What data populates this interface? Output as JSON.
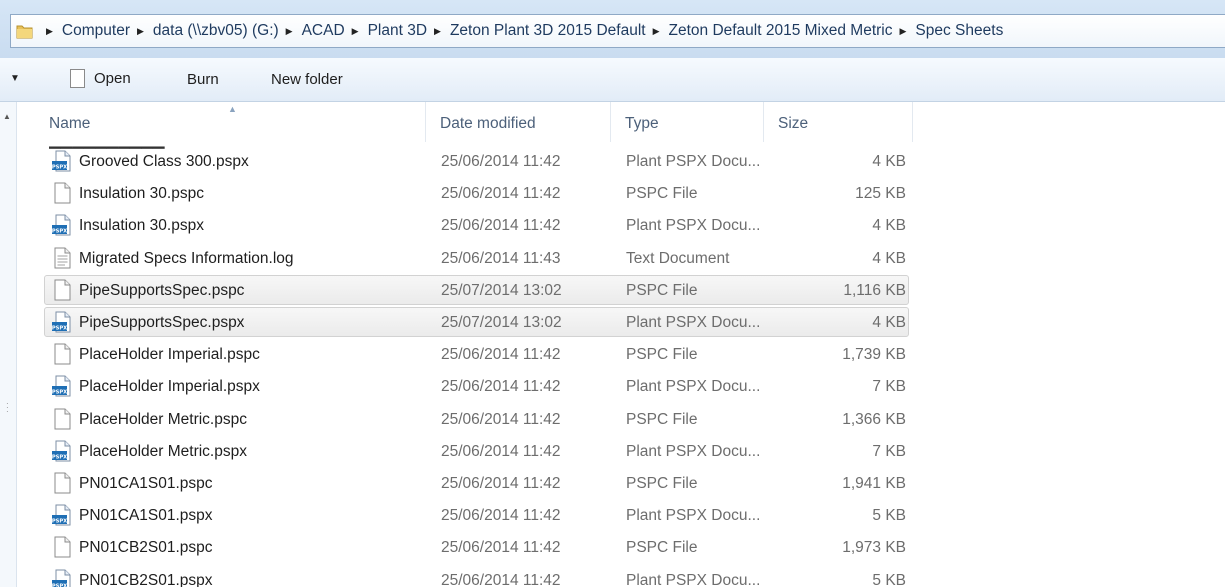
{
  "address_bar": {
    "path": [
      "Computer",
      "data (\\\\zbv05) (G:)",
      "ACAD",
      "Plant 3D",
      "Zeton Plant 3D 2015 Default",
      "Zeton Default 2015 Mixed Metric",
      "Spec Sheets"
    ]
  },
  "toolbar": {
    "open_label": "Open",
    "burn_label": "Burn",
    "new_folder_label": "New folder"
  },
  "columns": {
    "name": "Name",
    "date_modified": "Date modified",
    "type": "Type",
    "size": "Size"
  },
  "files": [
    {
      "name": "Grooved Class 300.pspx",
      "date": "25/06/2014 11:42",
      "type": "Plant PSPX Docu...",
      "size": "4 KB",
      "icon": "pspx-icon"
    },
    {
      "name": "Insulation 30.pspc",
      "date": "25/06/2014 11:42",
      "type": "PSPC File",
      "size": "125 KB",
      "icon": "blank-file-icon"
    },
    {
      "name": "Insulation 30.pspx",
      "date": "25/06/2014 11:42",
      "type": "Plant PSPX Docu...",
      "size": "4 KB",
      "icon": "pspx-icon"
    },
    {
      "name": "Migrated Specs Information.log",
      "date": "25/06/2014 11:43",
      "type": "Text Document",
      "size": "4 KB",
      "icon": "text-file-icon"
    },
    {
      "name": "PipeSupportsSpec.pspc",
      "date": "25/07/2014 13:02",
      "type": "PSPC File",
      "size": "1,116 KB",
      "icon": "blank-file-icon"
    },
    {
      "name": "PipeSupportsSpec.pspx",
      "date": "25/07/2014 13:02",
      "type": "Plant PSPX Docu...",
      "size": "4 KB",
      "icon": "pspx-icon"
    },
    {
      "name": "PlaceHolder Imperial.pspc",
      "date": "25/06/2014 11:42",
      "type": "PSPC File",
      "size": "1,739 KB",
      "icon": "blank-file-icon"
    },
    {
      "name": "PlaceHolder Imperial.pspx",
      "date": "25/06/2014 11:42",
      "type": "Plant PSPX Docu...",
      "size": "7 KB",
      "icon": "pspx-icon"
    },
    {
      "name": "PlaceHolder Metric.pspc",
      "date": "25/06/2014 11:42",
      "type": "PSPC File",
      "size": "1,366 KB",
      "icon": "blank-file-icon"
    },
    {
      "name": "PlaceHolder Metric.pspx",
      "date": "25/06/2014 11:42",
      "type": "Plant PSPX Docu...",
      "size": "7 KB",
      "icon": "pspx-icon"
    },
    {
      "name": "PN01CA1S01.pspc",
      "date": "25/06/2014 11:42",
      "type": "PSPC File",
      "size": "1,941 KB",
      "icon": "blank-file-icon"
    },
    {
      "name": "PN01CA1S01.pspx",
      "date": "25/06/2014 11:42",
      "type": "Plant PSPX Docu...",
      "size": "5 KB",
      "icon": "pspx-icon"
    },
    {
      "name": "PN01CB2S01.pspc",
      "date": "25/06/2014 11:42",
      "type": "PSPC File",
      "size": "1,973 KB",
      "icon": "blank-file-icon"
    },
    {
      "name": "PN01CB2S01.pspx",
      "date": "25/06/2014 11:42",
      "type": "Plant PSPX Docu...",
      "size": "5 KB",
      "icon": "pspx-icon"
    }
  ],
  "highlighted_rows": [
    4,
    5
  ],
  "icon_label": "PSPX"
}
